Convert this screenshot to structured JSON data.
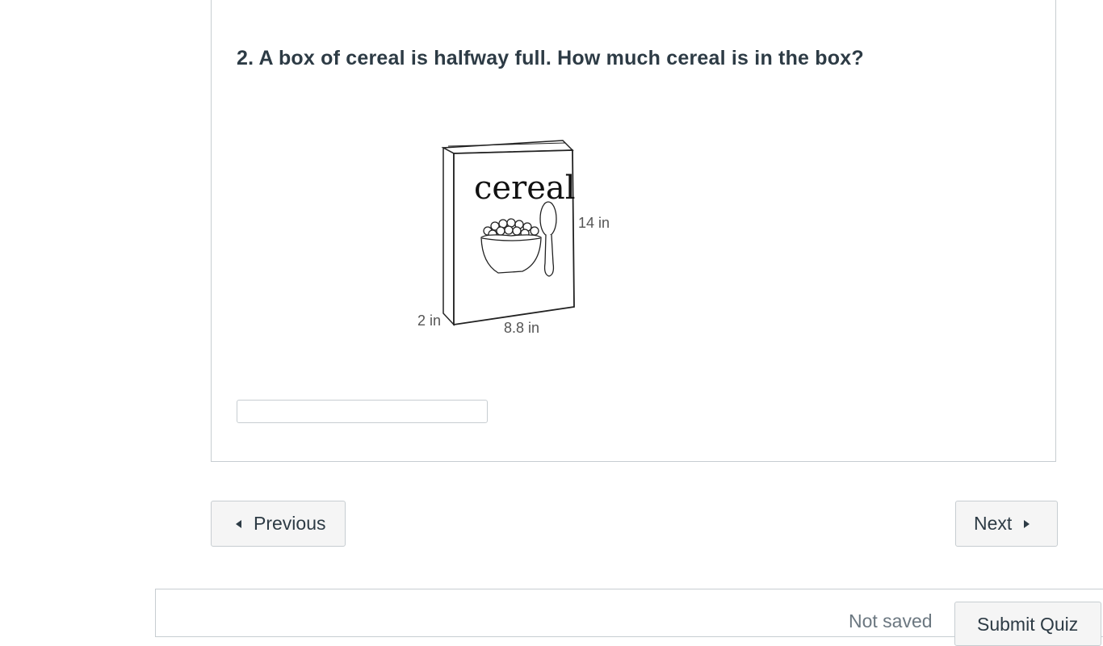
{
  "question": {
    "text": "2. A box of cereal is halfway full. How much cereal is in the box?",
    "answer_value": ""
  },
  "figure": {
    "box_label": "cereal",
    "height_label": "14 in",
    "depth_label": "2 in",
    "width_label": "8.8 in"
  },
  "navigation": {
    "previous_label": "Previous",
    "next_label": "Next"
  },
  "footer": {
    "status_text": "Not saved",
    "submit_label": "Submit Quiz"
  }
}
